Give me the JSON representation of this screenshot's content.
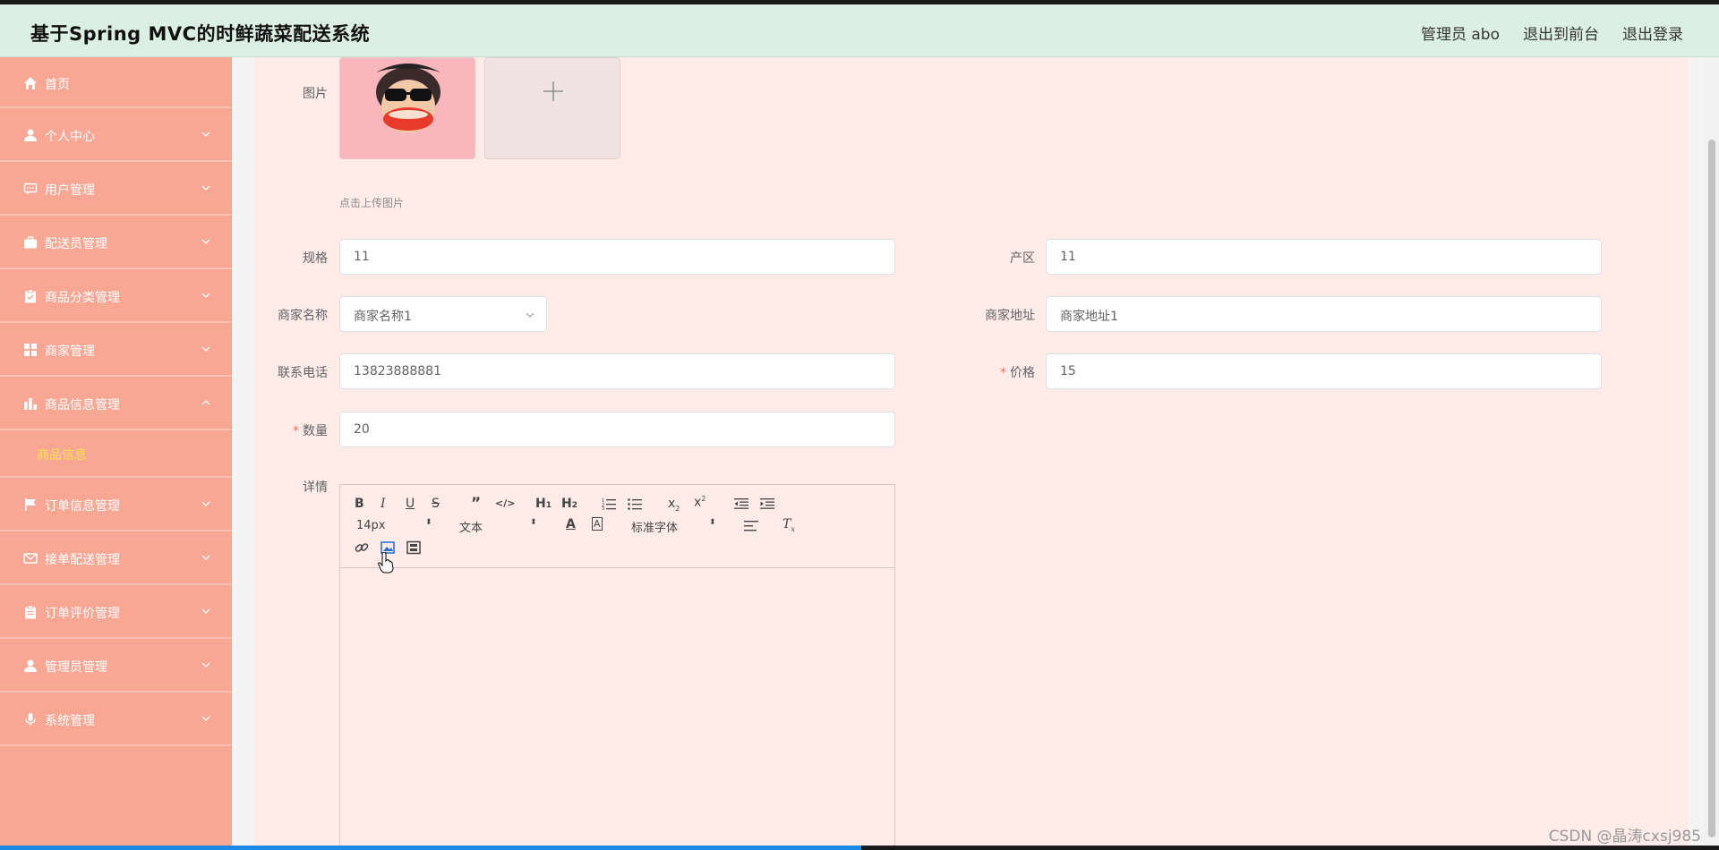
{
  "app": {
    "title": "基于Spring MVC的时鲜蔬菜配送系统"
  },
  "header": {
    "user": "管理员 abo",
    "to_front": "退出到前台",
    "logout": "退出登录"
  },
  "sidebar": {
    "items": [
      {
        "label": "首页",
        "icon": "home-icon"
      },
      {
        "label": "个人中心",
        "icon": "user-icon"
      },
      {
        "label": "用户管理",
        "icon": "chat-icon"
      },
      {
        "label": "配送员管理",
        "icon": "briefcase-icon"
      },
      {
        "label": "商品分类管理",
        "icon": "clipboard-check-icon"
      },
      {
        "label": "商家管理",
        "icon": "grid-icon"
      },
      {
        "label": "商品信息管理",
        "icon": "bar-chart-icon",
        "expanded": true
      },
      {
        "label": "订单信息管理",
        "icon": "flag-icon"
      },
      {
        "label": "接单配送管理",
        "icon": "mail-icon"
      },
      {
        "label": "订单评价管理",
        "icon": "clipboard-icon"
      },
      {
        "label": "管理员管理",
        "icon": "user-icon"
      },
      {
        "label": "系统管理",
        "icon": "mic-icon"
      }
    ],
    "submenu": {
      "label": "商品信息"
    }
  },
  "form": {
    "image_label": "图片",
    "upload_hint": "点击上传图片",
    "spec_label": "规格",
    "spec_value": "11",
    "origin_label": "产区",
    "origin_value": "11",
    "merchant_name_label": "商家名称",
    "merchant_name_value": "商家名称1",
    "merchant_addr_label": "商家地址",
    "merchant_addr_value": "商家地址1",
    "phone_label": "联系电话",
    "phone_value": "13823888881",
    "price_label": "价格",
    "price_value": "15",
    "qty_label": "数量",
    "qty_value": "20",
    "detail_label": "详情"
  },
  "editor": {
    "size": "14px",
    "header_picker": "文本",
    "font_picker": "标准字体"
  },
  "watermark": "CSDN @晶涛cxsj985",
  "colors": {
    "sidebar": "#f9a795",
    "header": "#dcefe5",
    "content": "#ffece8",
    "active_sub": "#f7e24f",
    "required": "#f56c6c"
  }
}
